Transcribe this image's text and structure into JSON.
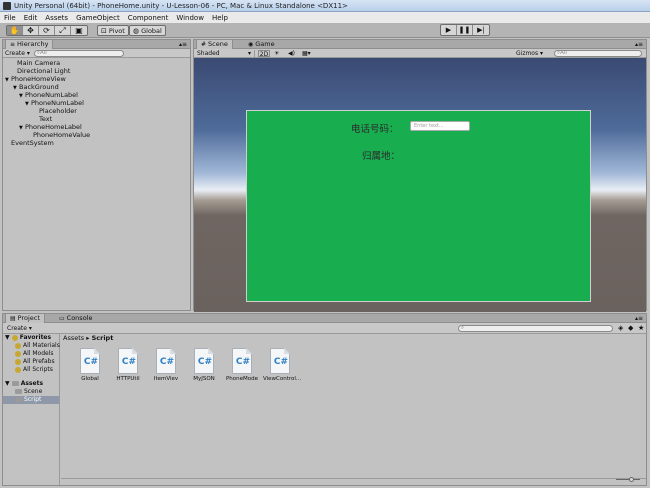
{
  "window": {
    "title": "Unity Personal (64bit) - PhoneHome.unity - U-Lesson-06 - PC, Mac & Linux Standalone <DX11>"
  },
  "menu": [
    "File",
    "Edit",
    "Assets",
    "GameObject",
    "Component",
    "Window",
    "Help"
  ],
  "toolbar": {
    "pivot_label": "Pivot",
    "global_label": "Global"
  },
  "hierarchy": {
    "tab_label": "Hierarchy",
    "create_label": "Create",
    "search_placeholder": "All",
    "items": [
      {
        "label": "Main Camera",
        "depth": 0,
        "expanded": null
      },
      {
        "label": "Directional Light",
        "depth": 0,
        "expanded": null
      },
      {
        "label": "PhoneHomeView",
        "depth": 0,
        "expanded": true
      },
      {
        "label": "BackGround",
        "depth": 1,
        "expanded": true
      },
      {
        "label": "PhoneNumLabel",
        "depth": 2,
        "expanded": true
      },
      {
        "label": "PhoneNumLabel",
        "depth": 3,
        "expanded": true
      },
      {
        "label": "Placeholder",
        "depth": 4,
        "expanded": null
      },
      {
        "label": "Text",
        "depth": 4,
        "expanded": null
      },
      {
        "label": "PhoneHomeLabel",
        "depth": 2,
        "expanded": true
      },
      {
        "label": "PhoneHomeValue",
        "depth": 3,
        "expanded": null
      },
      {
        "label": "EventSystem",
        "depth": 0,
        "expanded": null
      }
    ]
  },
  "scene": {
    "tab_scene": "Scene",
    "tab_game": "Game",
    "shading": "Shaded",
    "mode_2d": "2D",
    "gizmos": "Gizmos",
    "search_placeholder": "All",
    "phone_label": "电话号码：",
    "phone_input_placeholder": "Enter text...",
    "home_label": "归属地："
  },
  "project": {
    "tab_project": "Project",
    "tab_console": "Console",
    "create_label": "Create",
    "favorites_header": "Favorites",
    "favorites": [
      "All Materials",
      "All Models",
      "All Prefabs",
      "All Scripts"
    ],
    "assets_header": "Assets",
    "asset_folders": [
      "Scene",
      "Script"
    ],
    "breadcrumb_root": "Assets",
    "breadcrumb_current": "Script",
    "files": [
      "Global",
      "HTTPUtil",
      "ItemViev",
      "MyJSON",
      "PhoneMode",
      "ViewControl..."
    ]
  },
  "colors": {
    "canvas_green": "#18ad4f",
    "panel_gray": "#c2c2c2"
  }
}
